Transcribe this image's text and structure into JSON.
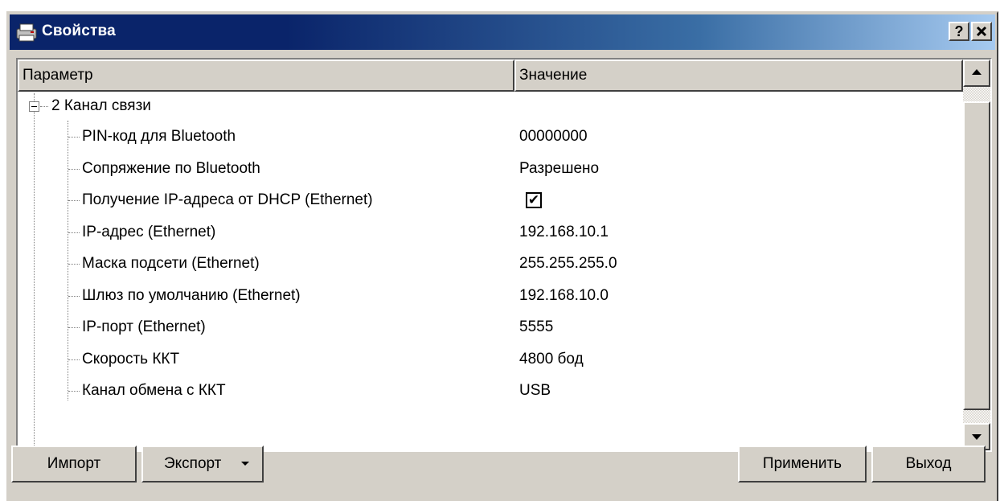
{
  "window": {
    "title": "Свойства",
    "help_label": "?",
    "close_label": "✕"
  },
  "table": {
    "columns": [
      "Параметр",
      "Значение"
    ],
    "group": {
      "expander": "−",
      "label": "2 Канал связи"
    },
    "rows": [
      {
        "param": "PIN-код для Bluetooth",
        "value": "00000000"
      },
      {
        "param": "Сопряжение по Bluetooth",
        "value": "Разрешено"
      },
      {
        "param": "Получение IP-адреса от DHCP (Ethernet)",
        "value": "",
        "checked": true
      },
      {
        "param": "IP-адрес (Ethernet)",
        "value": "192.168.10.1"
      },
      {
        "param": "Маска подсети (Ethernet)",
        "value": "255.255.255.0"
      },
      {
        "param": "Шлюз по умолчанию (Ethernet)",
        "value": "192.168.10.0"
      },
      {
        "param": "IP-порт (Ethernet)",
        "value": "5555"
      },
      {
        "param": "Скорость ККТ",
        "value": "4800 бод"
      },
      {
        "param": "Канал обмена с ККТ",
        "value": "USB"
      }
    ]
  },
  "checkbox_mark": "✔",
  "buttons": {
    "import": "Импорт",
    "export": "Экспорт",
    "apply": "Применить",
    "exit": "Выход"
  }
}
